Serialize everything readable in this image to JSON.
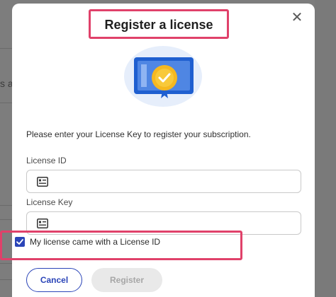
{
  "background": {
    "partial_text": "s a"
  },
  "modal": {
    "title": "Register a license",
    "close_glyph": "✕",
    "intro": "Please enter your License Key to register your subscription.",
    "license_id": {
      "label": "License ID",
      "value": "",
      "icon": "id-card-icon"
    },
    "license_key": {
      "label": "License Key",
      "value": "",
      "icon": "id-card-icon"
    },
    "checkbox": {
      "label": "My license came with a License ID",
      "checked": true
    },
    "buttons": {
      "cancel": "Cancel",
      "register": "Register"
    }
  },
  "colors": {
    "accent": "#2b45b8",
    "highlight": "#e0416a",
    "badge": "#f5b820",
    "certificate": "#1f5fd0"
  }
}
